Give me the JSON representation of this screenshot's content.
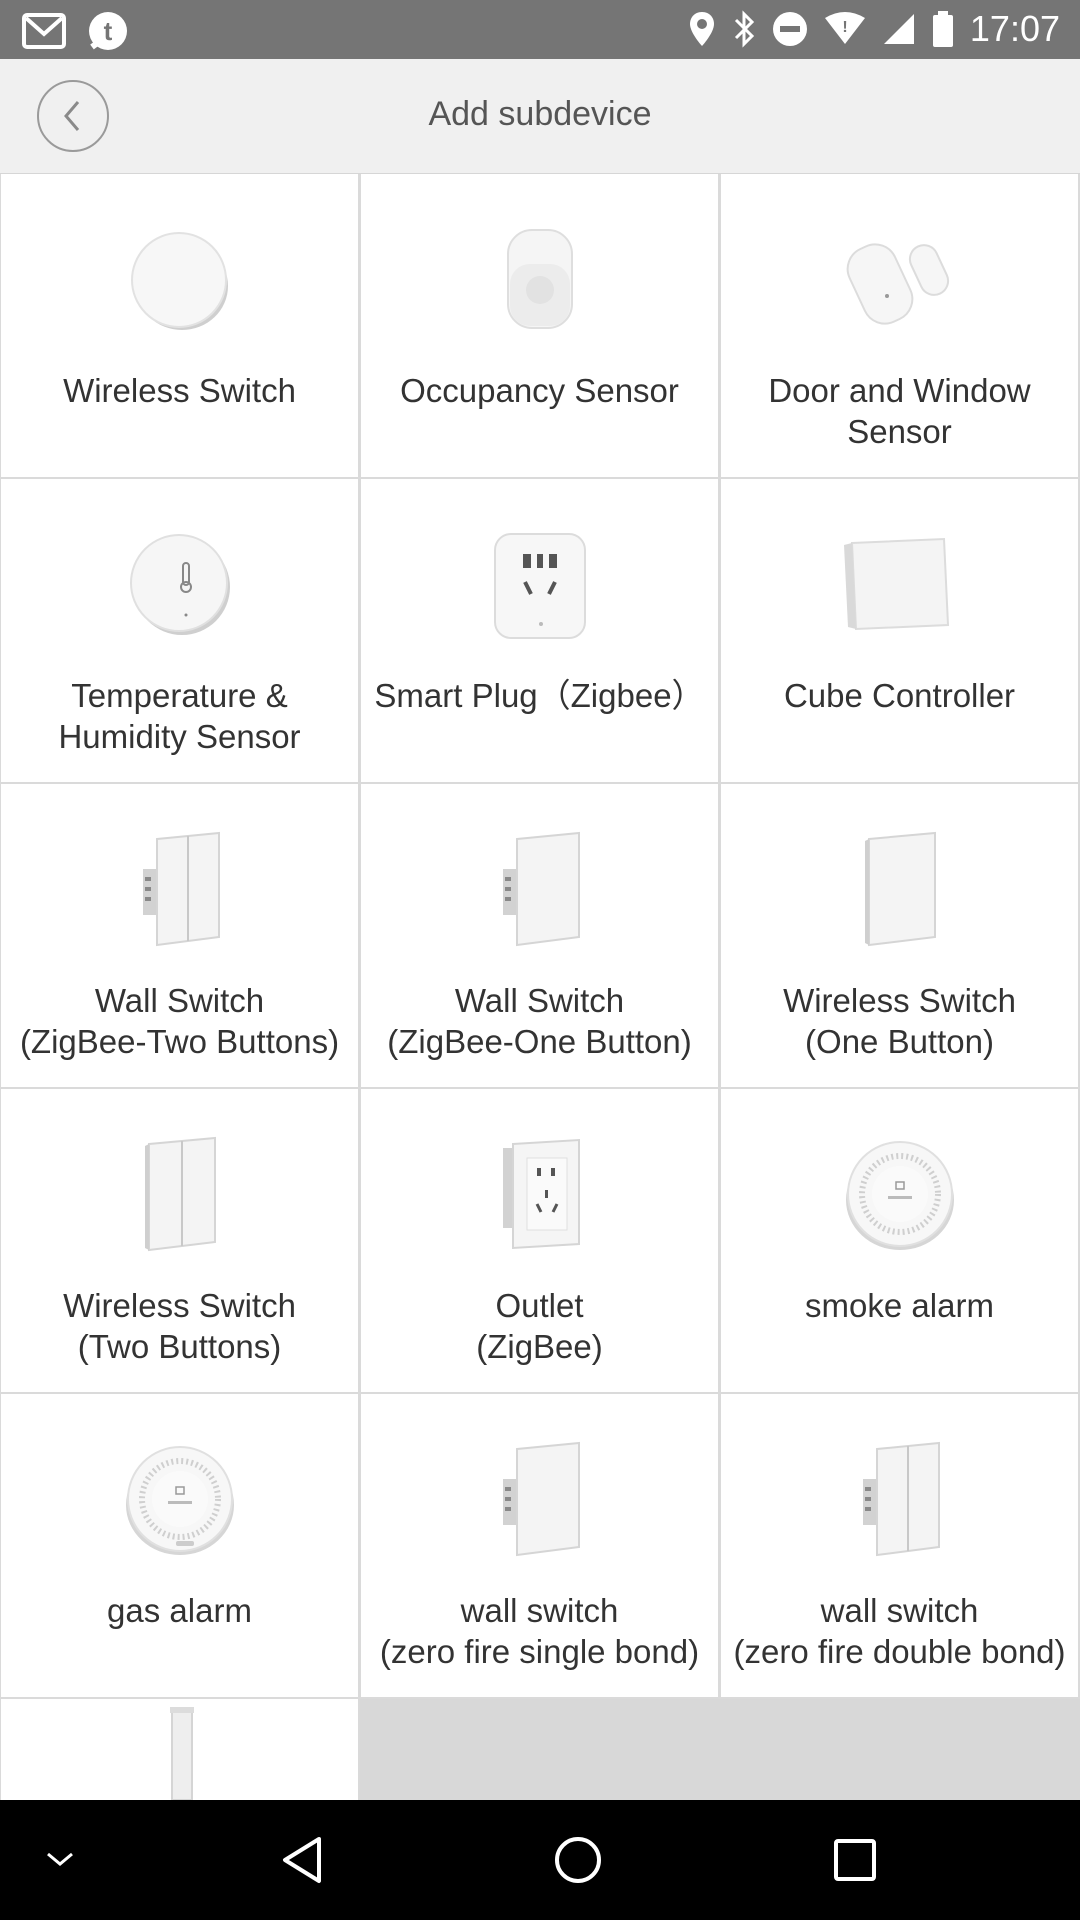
{
  "status_bar": {
    "time": "17:07",
    "left_icons": [
      "gmail-icon",
      "notification-t-icon"
    ],
    "right_icons": [
      "location-icon",
      "bluetooth-icon",
      "do-not-disturb-icon",
      "wifi-icon",
      "signal-icon",
      "battery-icon"
    ]
  },
  "header": {
    "title": "Add subdevice",
    "back_icon": "chevron-left-icon"
  },
  "devices": [
    {
      "label": "Wireless Switch",
      "icon": "round-button-device"
    },
    {
      "label": "Occupancy Sensor",
      "icon": "motion-sensor-device"
    },
    {
      "label": "Door and Window\nSensor",
      "icon": "door-sensor-device"
    },
    {
      "label": "Temperature &\nHumidity Sensor",
      "icon": "thermometer-sensor-device"
    },
    {
      "label": "Smart Plug（Zigbee）",
      "icon": "smart-plug-device"
    },
    {
      "label": "Cube Controller",
      "icon": "cube-device"
    },
    {
      "label": "Wall Switch\n(ZigBee-Two Buttons)",
      "icon": "wall-switch-two-device"
    },
    {
      "label": "Wall Switch\n(ZigBee-One Button)",
      "icon": "wall-switch-one-device"
    },
    {
      "label": "Wireless Switch\n(One Button)",
      "icon": "wireless-switch-one-device"
    },
    {
      "label": "Wireless Switch\n(Two Buttons)",
      "icon": "wireless-switch-two-device"
    },
    {
      "label": "Outlet\n(ZigBee)",
      "icon": "outlet-device"
    },
    {
      "label": "smoke alarm",
      "icon": "smoke-alarm-device"
    },
    {
      "label": "gas alarm",
      "icon": "gas-alarm-device"
    },
    {
      "label": "wall switch\n(zero fire single bond)",
      "icon": "wall-switch-one-device"
    },
    {
      "label": "wall switch\n(zero fire double bond)",
      "icon": "wall-switch-two-device"
    },
    {
      "label": "",
      "icon": "curtain-device"
    }
  ],
  "nav_bar": {
    "items": [
      "hide-keyboard-icon",
      "back-triangle-icon",
      "home-circle-icon",
      "recents-square-icon"
    ]
  },
  "colors": {
    "status_bar": "#757575",
    "header": "#f0f0f0",
    "grid_border": "#dadada",
    "nav_bar": "#000000"
  }
}
